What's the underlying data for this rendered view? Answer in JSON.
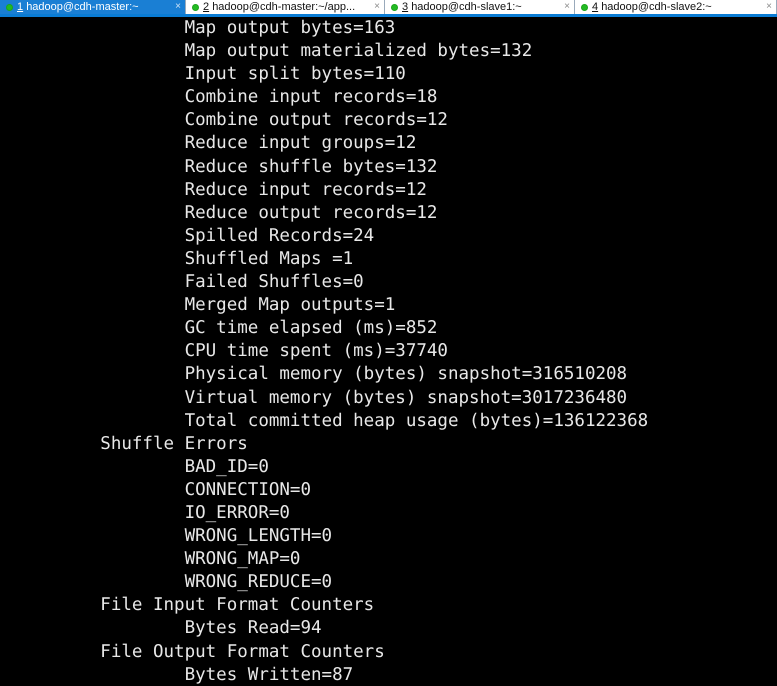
{
  "window": {
    "type": "terminal-emulator",
    "background_color": "#000000",
    "foreground_color": "#e8e8e8",
    "accent_color": "#0a7cd4"
  },
  "tabbar": {
    "tabs": [
      {
        "number": "1",
        "title": "hadoop@cdh-master:~",
        "full_label": "1 hadoop@cdh-master:~",
        "status": "connected",
        "active": true,
        "close_label": "×"
      },
      {
        "number": "2",
        "title": "hadoop@cdh-master:~/app...",
        "full_label": "2 hadoop@cdh-master:~/app...",
        "status": "connected",
        "active": false,
        "close_label": "×"
      },
      {
        "number": "3",
        "title": "hadoop@cdh-slave1:~",
        "full_label": "3 hadoop@cdh-slave1:~",
        "status": "connected",
        "active": false,
        "close_label": "×"
      },
      {
        "number": "4",
        "title": "hadoop@cdh-slave2:~",
        "full_label": "4 hadoop@cdh-slave2:~",
        "status": "connected",
        "active": false,
        "close_label": "×"
      }
    ]
  },
  "terminal": {
    "lines": [
      "\t\tMap output bytes=163",
      "\t\tMap output materialized bytes=132",
      "\t\tInput split bytes=110",
      "\t\tCombine input records=18",
      "\t\tCombine output records=12",
      "\t\tReduce input groups=12",
      "\t\tReduce shuffle bytes=132",
      "\t\tReduce input records=12",
      "\t\tReduce output records=12",
      "\t\tSpilled Records=24",
      "\t\tShuffled Maps =1",
      "\t\tFailed Shuffles=0",
      "\t\tMerged Map outputs=1",
      "\t\tGC time elapsed (ms)=852",
      "\t\tCPU time spent (ms)=37740",
      "\t\tPhysical memory (bytes) snapshot=316510208",
      "\t\tVirtual memory (bytes) snapshot=3017236480",
      "\t\tTotal committed heap usage (bytes)=136122368",
      "\tShuffle Errors",
      "\t\tBAD_ID=0",
      "\t\tCONNECTION=0",
      "\t\tIO_ERROR=0",
      "\t\tWRONG_LENGTH=0",
      "\t\tWRONG_MAP=0",
      "\t\tWRONG_REDUCE=0",
      "\tFile Input Format Counters ",
      "\t\tBytes Read=94",
      "\tFile Output Format Counters ",
      "\t\tBytes Written=87"
    ]
  }
}
